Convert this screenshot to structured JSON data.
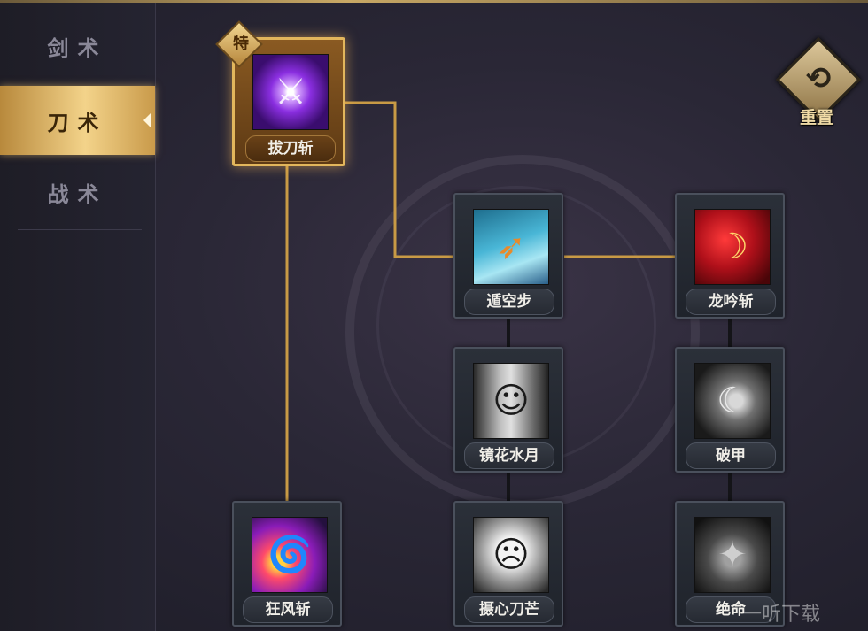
{
  "sidebar": {
    "tabs": [
      {
        "label": "剑术",
        "active": false
      },
      {
        "label": "刀术",
        "active": true
      },
      {
        "label": "战术",
        "active": false
      }
    ]
  },
  "skills": {
    "badao": {
      "name": "拔刀斩",
      "badge": "特",
      "icon": "sword-purple-icon"
    },
    "dunkong": {
      "name": "遁空步",
      "icon": "boot-dash-icon"
    },
    "longyin": {
      "name": "龙吟斩",
      "icon": "dragon-blade-icon"
    },
    "jinghua": {
      "name": "镜花水月",
      "icon": "mirror-face-icon"
    },
    "pojia": {
      "name": "破甲",
      "icon": "armor-break-icon"
    },
    "kuangfeng": {
      "name": "狂风斩",
      "icon": "whirlwind-slash-icon"
    },
    "shexin": {
      "name": "摄心刀芒",
      "icon": "scream-face-icon"
    },
    "jueming": {
      "name": "绝命",
      "icon": "death-blade-icon"
    }
  },
  "reset": {
    "label": "重置",
    "icon": "reset-arrows-icon"
  },
  "watermark": "一听下载",
  "colors": {
    "accent": "#e2b65c",
    "active_tab": "#f3d38a",
    "line": "#c89a45"
  }
}
